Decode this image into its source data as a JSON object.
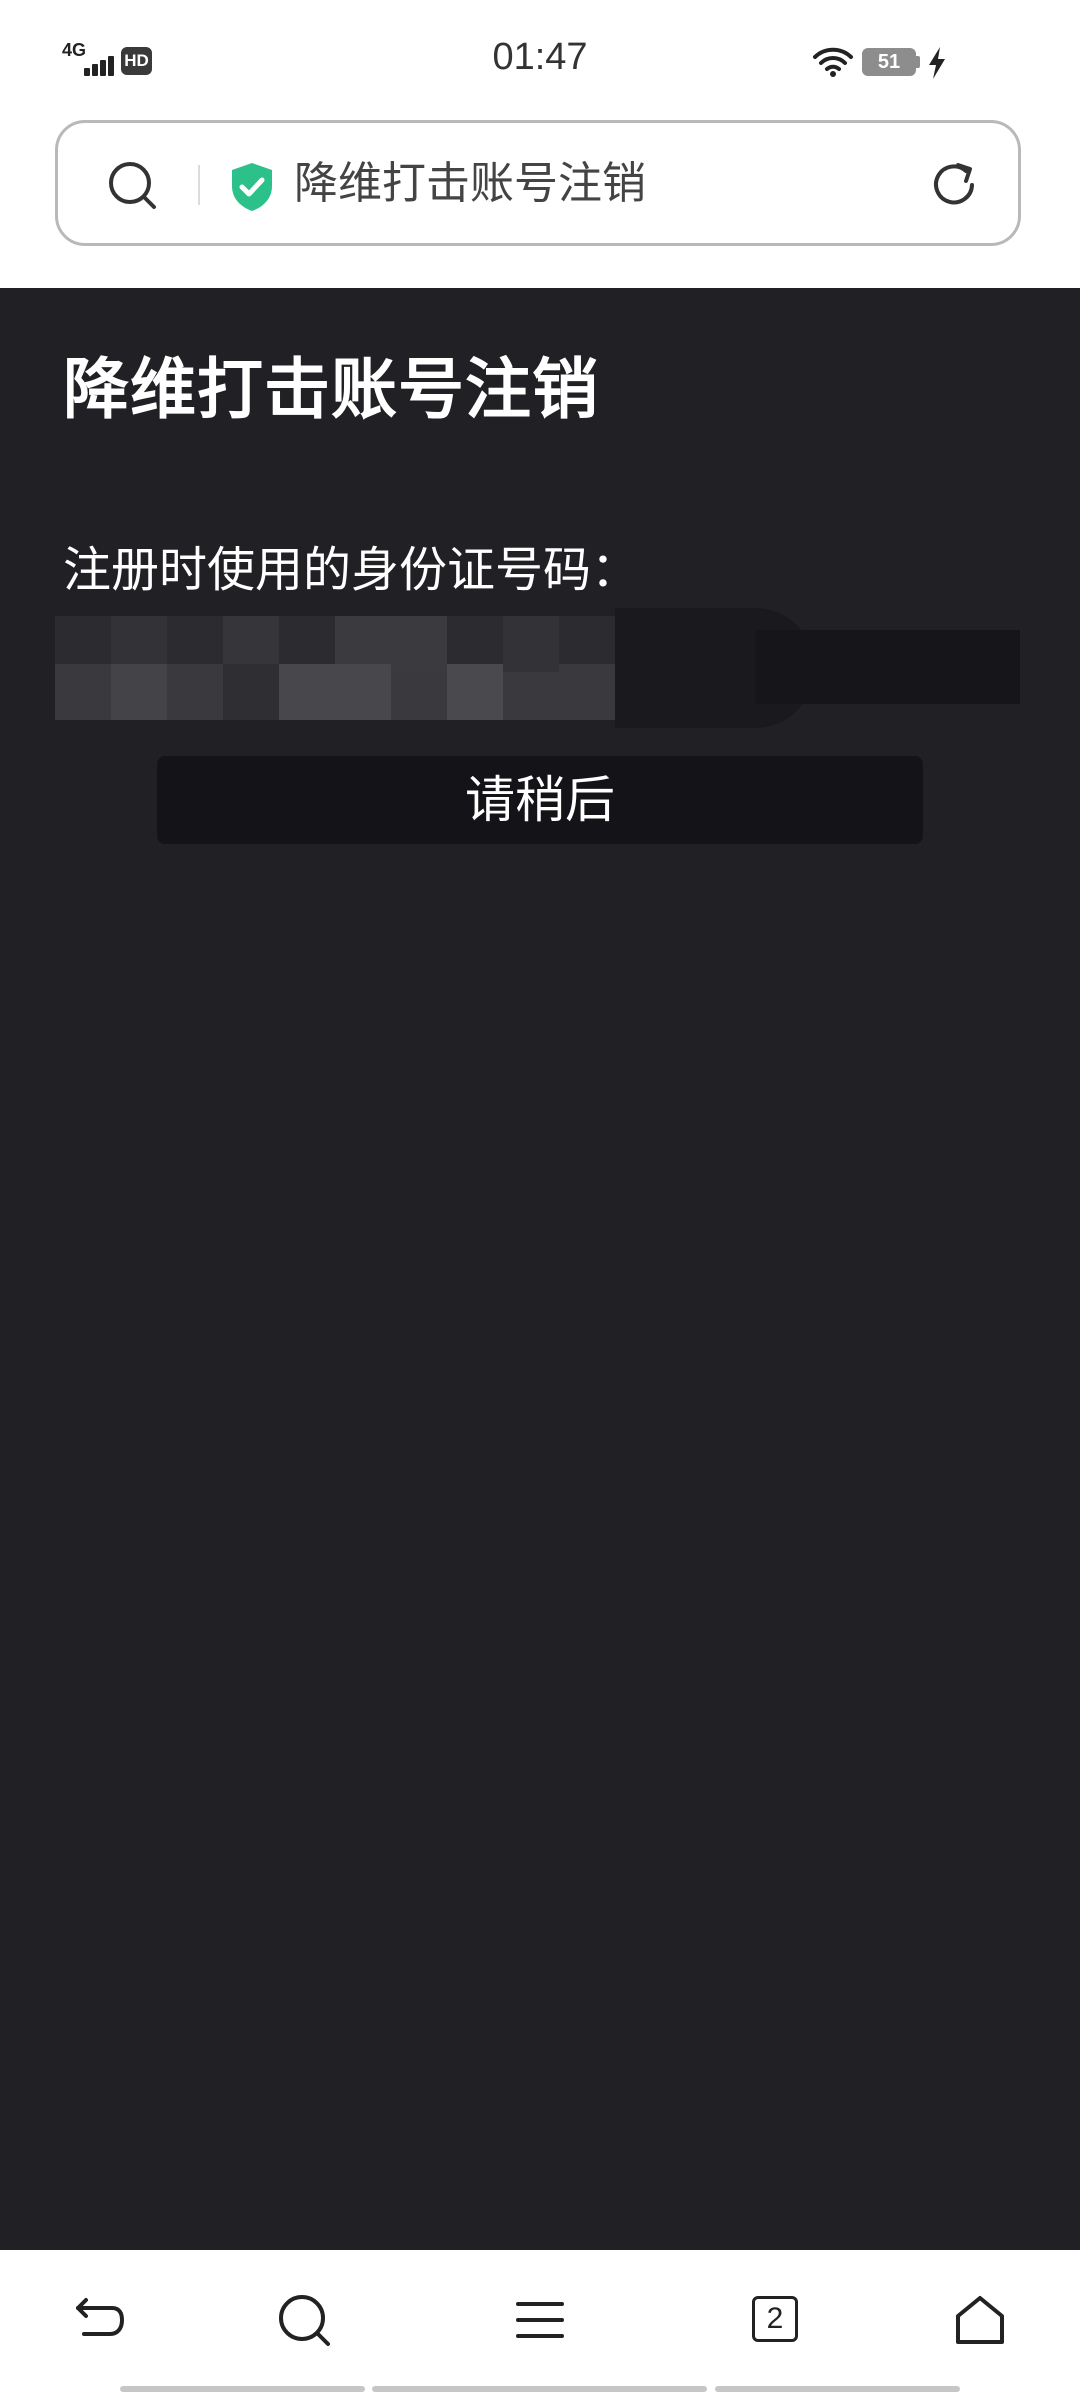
{
  "status_bar": {
    "network": "4G",
    "hd_badge": "HD",
    "time": "01:47",
    "battery": "51",
    "icons": [
      "signal-icon",
      "wifi-icon",
      "battery-icon",
      "charging-icon"
    ]
  },
  "address_bar": {
    "title": "降维打击账号注销",
    "icons": [
      "search-icon",
      "shield-check-icon",
      "refresh-icon"
    ],
    "shield_color": "#2cc18a"
  },
  "page": {
    "title": "降维打击账号注销",
    "id_label": "注册时使用的身份证号码：",
    "button_label": "请稍后",
    "background": "#202025"
  },
  "bottom_nav": {
    "tab_count": "2",
    "icons": [
      "back-icon",
      "search-icon",
      "menu-icon",
      "tabs-icon",
      "home-icon"
    ]
  }
}
